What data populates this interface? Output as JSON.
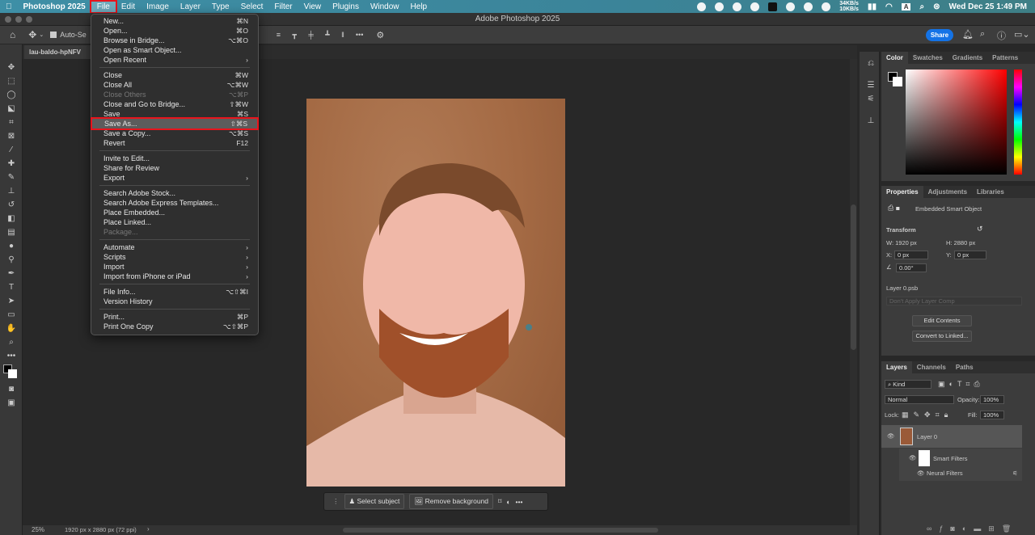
{
  "menubar": {
    "app": "Photoshop 2025",
    "items": [
      "File",
      "Edit",
      "Image",
      "Layer",
      "Type",
      "Select",
      "Filter",
      "View",
      "Plugins",
      "Window",
      "Help"
    ],
    "net_up": "34KB/s",
    "net_down": "10KB/s",
    "input": "A",
    "datetime": "Wed Dec 25  1:49 PM"
  },
  "window": {
    "title": "Adobe Photoshop 2025"
  },
  "options": {
    "auto_select": "Auto-Se",
    "share": "Share"
  },
  "document": {
    "tab": "lau-baldo-hpNFV",
    "zoom": "25%",
    "info": "1920 px x 2880 px (72 ppi)"
  },
  "file_menu": [
    [
      {
        "label": "New...",
        "sc": "⌘N"
      },
      {
        "label": "Open...",
        "sc": "⌘O"
      },
      {
        "label": "Browse in Bridge...",
        "sc": "⌥⌘O"
      },
      {
        "label": "Open as Smart Object...",
        "sc": ""
      },
      {
        "label": "Open Recent",
        "sc": "›"
      }
    ],
    [
      {
        "label": "Close",
        "sc": "⌘W"
      },
      {
        "label": "Close All",
        "sc": "⌥⌘W"
      },
      {
        "label": "Close Others",
        "sc": "⌥⌘P",
        "disabled": true
      },
      {
        "label": "Close and Go to Bridge...",
        "sc": "⇧⌘W"
      },
      {
        "label": "Save",
        "sc": "⌘S"
      },
      {
        "label": "Save As...",
        "sc": "⇧⌘S",
        "highlighted": true
      },
      {
        "label": "Save a Copy...",
        "sc": "⌥⌘S"
      },
      {
        "label": "Revert",
        "sc": "F12"
      }
    ],
    [
      {
        "label": "Invite to Edit...",
        "sc": ""
      },
      {
        "label": "Share for Review",
        "sc": ""
      },
      {
        "label": "Export",
        "sc": "›"
      }
    ],
    [
      {
        "label": "Search Adobe Stock...",
        "sc": ""
      },
      {
        "label": "Search Adobe Express Templates...",
        "sc": ""
      },
      {
        "label": "Place Embedded...",
        "sc": ""
      },
      {
        "label": "Place Linked...",
        "sc": ""
      },
      {
        "label": "Package...",
        "sc": "",
        "disabled": true
      }
    ],
    [
      {
        "label": "Automate",
        "sc": "›"
      },
      {
        "label": "Scripts",
        "sc": "›"
      },
      {
        "label": "Import",
        "sc": "›"
      },
      {
        "label": "Import from iPhone or iPad",
        "sc": "›"
      }
    ],
    [
      {
        "label": "File Info...",
        "sc": "⌥⇧⌘I"
      },
      {
        "label": "Version History",
        "sc": ""
      }
    ],
    [
      {
        "label": "Print...",
        "sc": "⌘P"
      },
      {
        "label": "Print One Copy",
        "sc": "⌥⇧⌘P"
      }
    ]
  ],
  "context_bar": {
    "select_subject": "Select subject",
    "remove_background": "Remove background"
  },
  "color_panel": {
    "tabs": [
      "Color",
      "Swatches",
      "Gradients",
      "Patterns"
    ],
    "hue_color": "#ff0000"
  },
  "properties": {
    "tabs": [
      "Properties",
      "Adjustments",
      "Libraries"
    ],
    "type": "Embedded Smart Object",
    "transform": "Transform",
    "w": "W:  1920 px",
    "h": "H:  2880 px",
    "x_label": "X:",
    "x": "0 px",
    "y_label": "Y:",
    "y": "0 px",
    "angle": "0.00°",
    "file": "Layer 0.psb",
    "comp": "Don't Apply Layer Comp",
    "edit": "Edit Contents",
    "convert": "Convert to Linked..."
  },
  "layers": {
    "tabs": [
      "Layers",
      "Channels",
      "Paths"
    ],
    "kind": "Kind",
    "blend": "Normal",
    "opacity_label": "Opacity:",
    "opacity": "100%",
    "lock": "Lock:",
    "fill_label": "Fill:",
    "fill": "100%",
    "items": [
      {
        "name": "Layer 0"
      },
      {
        "name": "Smart Filters"
      },
      {
        "name": "Neural Filters"
      }
    ]
  }
}
